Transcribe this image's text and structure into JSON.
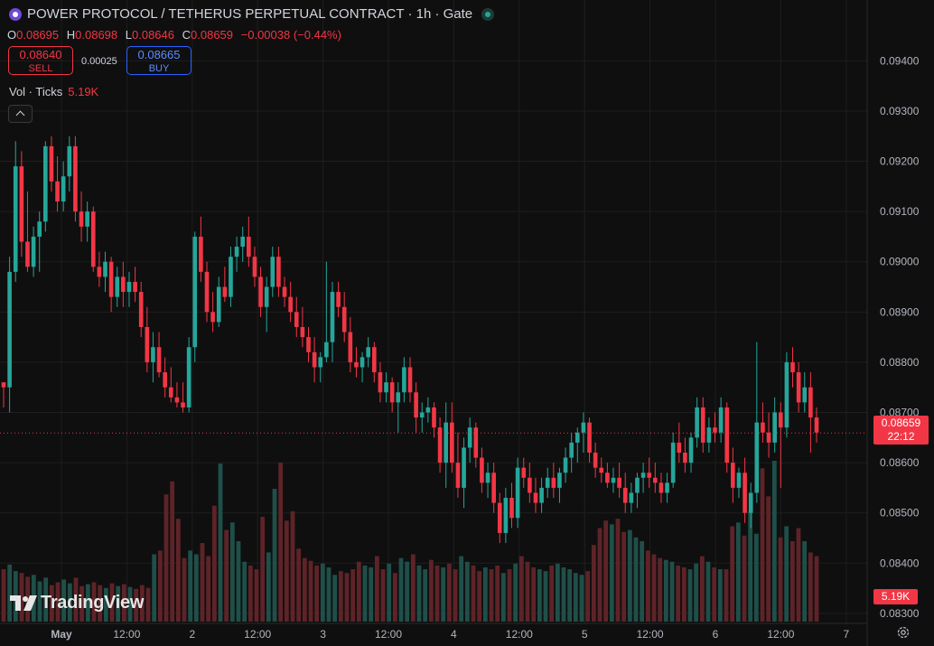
{
  "symbol": {
    "title": "POWER PROTOCOL / TETHERUS PERPETUAL CONTRACT · 1h · Gate",
    "icon": "power-protocol-icon",
    "status_icon": "market-open-dot-icon"
  },
  "ohlc": {
    "o_label": "O",
    "o": "0.08695",
    "h_label": "H",
    "h": "0.08698",
    "l_label": "L",
    "l": "0.08646",
    "c_label": "C",
    "c": "0.08659",
    "change": "−0.00038 (−0.44%)"
  },
  "trade": {
    "sell_price": "0.08640",
    "sell_label": "SELL",
    "spread": "0.00025",
    "buy_price": "0.08665",
    "buy_label": "BUY"
  },
  "volume": {
    "label": "Vol · Ticks",
    "value": "5.19K",
    "tag": "5.19K"
  },
  "price_tag": {
    "price": "0.08659",
    "countdown": "22:12"
  },
  "branding": {
    "name": "TradingView"
  },
  "colors": {
    "up": "#26a69a",
    "down": "#f23645",
    "background": "#0f0f0f",
    "grid": "#1e1e1e"
  },
  "chart_data": {
    "type": "candlestick",
    "interval": "1h",
    "ylim": [
      0.0828,
      0.0946
    ],
    "y_ticks": [
      "0.09400",
      "0.09300",
      "0.09200",
      "0.09100",
      "0.09000",
      "0.08900",
      "0.08800",
      "0.08700",
      "0.08600",
      "0.08500",
      "0.08400",
      "0.08300"
    ],
    "x_ticks": [
      "May",
      "12:00",
      "2",
      "12:00",
      "3",
      "12:00",
      "4",
      "12:00",
      "5",
      "12:00",
      "6",
      "12:00",
      "7"
    ],
    "last_price": 0.08659,
    "candles_ohlc": [
      [
        0.0876,
        0.0876,
        0.0871,
        0.0875
      ],
      [
        0.0875,
        0.0901,
        0.087,
        0.0898
      ],
      [
        0.0898,
        0.0924,
        0.0896,
        0.0919
      ],
      [
        0.0919,
        0.0922,
        0.0901,
        0.0904
      ],
      [
        0.0904,
        0.0914,
        0.0898,
        0.0899
      ],
      [
        0.0899,
        0.0907,
        0.0897,
        0.0905
      ],
      [
        0.0905,
        0.091,
        0.0898,
        0.0908
      ],
      [
        0.0908,
        0.0924,
        0.0906,
        0.0923
      ],
      [
        0.0923,
        0.0925,
        0.0914,
        0.0916
      ],
      [
        0.0916,
        0.0921,
        0.091,
        0.0912
      ],
      [
        0.0912,
        0.092,
        0.091,
        0.0917
      ],
      [
        0.0917,
        0.0925,
        0.0914,
        0.0923
      ],
      [
        0.0923,
        0.0925,
        0.0908,
        0.091
      ],
      [
        0.091,
        0.0914,
        0.0904,
        0.0907
      ],
      [
        0.0907,
        0.0912,
        0.0904,
        0.091
      ],
      [
        0.091,
        0.0911,
        0.0898,
        0.0899
      ],
      [
        0.0899,
        0.0902,
        0.0895,
        0.0897
      ],
      [
        0.0897,
        0.0902,
        0.0894,
        0.09
      ],
      [
        0.09,
        0.0901,
        0.089,
        0.0893
      ],
      [
        0.0893,
        0.0899,
        0.0891,
        0.0897
      ],
      [
        0.0897,
        0.09,
        0.0891,
        0.0894
      ],
      [
        0.0894,
        0.0898,
        0.0891,
        0.0896
      ],
      [
        0.0896,
        0.0899,
        0.0892,
        0.0894
      ],
      [
        0.0894,
        0.0896,
        0.0885,
        0.0887
      ],
      [
        0.0887,
        0.0891,
        0.0878,
        0.088
      ],
      [
        0.088,
        0.0886,
        0.0876,
        0.0883
      ],
      [
        0.0883,
        0.0886,
        0.0877,
        0.0878
      ],
      [
        0.0878,
        0.0881,
        0.0873,
        0.0875
      ],
      [
        0.0875,
        0.0879,
        0.0872,
        0.0873
      ],
      [
        0.0873,
        0.0876,
        0.0871,
        0.0872
      ],
      [
        0.0872,
        0.0876,
        0.087,
        0.0871
      ],
      [
        0.0871,
        0.0885,
        0.087,
        0.0883
      ],
      [
        0.0883,
        0.0906,
        0.088,
        0.0905
      ],
      [
        0.0905,
        0.0909,
        0.0896,
        0.0898
      ],
      [
        0.0898,
        0.09,
        0.0888,
        0.089
      ],
      [
        0.089,
        0.0894,
        0.0886,
        0.0888
      ],
      [
        0.0888,
        0.0897,
        0.0887,
        0.0895
      ],
      [
        0.0895,
        0.0899,
        0.0892,
        0.0893
      ],
      [
        0.0893,
        0.0903,
        0.0891,
        0.0901
      ],
      [
        0.0901,
        0.0905,
        0.0898,
        0.0903
      ],
      [
        0.0903,
        0.0907,
        0.09,
        0.0905
      ],
      [
        0.0905,
        0.0909,
        0.0899,
        0.0901
      ],
      [
        0.0901,
        0.0903,
        0.0895,
        0.0897
      ],
      [
        0.0897,
        0.0899,
        0.0889,
        0.0891
      ],
      [
        0.0891,
        0.0897,
        0.0886,
        0.0895
      ],
      [
        0.0895,
        0.0903,
        0.0893,
        0.0901
      ],
      [
        0.0901,
        0.0903,
        0.0893,
        0.0895
      ],
      [
        0.0895,
        0.0897,
        0.0891,
        0.0893
      ],
      [
        0.0893,
        0.0896,
        0.0888,
        0.089
      ],
      [
        0.089,
        0.0893,
        0.0885,
        0.0887
      ],
      [
        0.0887,
        0.0891,
        0.0883,
        0.0885
      ],
      [
        0.0885,
        0.0887,
        0.088,
        0.0882
      ],
      [
        0.0882,
        0.0885,
        0.0876,
        0.0879
      ],
      [
        0.0879,
        0.0882,
        0.0876,
        0.0881
      ],
      [
        0.0881,
        0.09,
        0.088,
        0.0884
      ],
      [
        0.0884,
        0.0896,
        0.088,
        0.0894
      ],
      [
        0.0894,
        0.0896,
        0.0889,
        0.0891
      ],
      [
        0.0891,
        0.0894,
        0.0884,
        0.0886
      ],
      [
        0.0886,
        0.0889,
        0.0878,
        0.088
      ],
      [
        0.088,
        0.0883,
        0.0877,
        0.0879
      ],
      [
        0.0879,
        0.0882,
        0.0876,
        0.0881
      ],
      [
        0.0881,
        0.0885,
        0.0879,
        0.0883
      ],
      [
        0.0883,
        0.0884,
        0.0876,
        0.0878
      ],
      [
        0.0878,
        0.088,
        0.0872,
        0.0874
      ],
      [
        0.0874,
        0.0878,
        0.0872,
        0.0876
      ],
      [
        0.0876,
        0.0877,
        0.087,
        0.0872
      ],
      [
        0.0872,
        0.0876,
        0.0866,
        0.0874
      ],
      [
        0.0874,
        0.0881,
        0.0872,
        0.0879
      ],
      [
        0.0879,
        0.0881,
        0.0872,
        0.0874
      ],
      [
        0.0874,
        0.0876,
        0.0866,
        0.0869
      ],
      [
        0.0869,
        0.0872,
        0.0866,
        0.087
      ],
      [
        0.087,
        0.0873,
        0.0868,
        0.0871
      ],
      [
        0.0871,
        0.0872,
        0.0865,
        0.0867
      ],
      [
        0.0867,
        0.0869,
        0.0858,
        0.086
      ],
      [
        0.086,
        0.0872,
        0.0855,
        0.0868
      ],
      [
        0.0868,
        0.0872,
        0.0858,
        0.086
      ],
      [
        0.086,
        0.0866,
        0.0853,
        0.0855
      ],
      [
        0.0855,
        0.0865,
        0.0851,
        0.0863
      ],
      [
        0.0863,
        0.0869,
        0.086,
        0.0867
      ],
      [
        0.0867,
        0.0868,
        0.0859,
        0.0861
      ],
      [
        0.0861,
        0.0863,
        0.0854,
        0.0856
      ],
      [
        0.0856,
        0.086,
        0.0853,
        0.0858
      ],
      [
        0.0858,
        0.086,
        0.085,
        0.0852
      ],
      [
        0.0852,
        0.0854,
        0.0844,
        0.0846
      ],
      [
        0.0846,
        0.0855,
        0.0844,
        0.0853
      ],
      [
        0.0853,
        0.0856,
        0.0847,
        0.0849
      ],
      [
        0.0849,
        0.0861,
        0.0847,
        0.0859
      ],
      [
        0.0859,
        0.0861,
        0.0855,
        0.0857
      ],
      [
        0.0857,
        0.086,
        0.0852,
        0.0854
      ],
      [
        0.0854,
        0.0857,
        0.085,
        0.0852
      ],
      [
        0.0852,
        0.0857,
        0.085,
        0.0855
      ],
      [
        0.0855,
        0.0859,
        0.0853,
        0.0857
      ],
      [
        0.0857,
        0.086,
        0.0853,
        0.0855
      ],
      [
        0.0855,
        0.0859,
        0.0852,
        0.0858
      ],
      [
        0.0858,
        0.0863,
        0.0856,
        0.0861
      ],
      [
        0.0861,
        0.0866,
        0.0858,
        0.0864
      ],
      [
        0.0864,
        0.0867,
        0.086,
        0.0866
      ],
      [
        0.0866,
        0.087,
        0.0862,
        0.0868
      ],
      [
        0.0868,
        0.0869,
        0.086,
        0.0862
      ],
      [
        0.0862,
        0.0864,
        0.0857,
        0.0859
      ],
      [
        0.0859,
        0.0861,
        0.0856,
        0.0858
      ],
      [
        0.0858,
        0.086,
        0.0855,
        0.0856
      ],
      [
        0.0856,
        0.0859,
        0.0854,
        0.0857
      ],
      [
        0.0857,
        0.086,
        0.0853,
        0.0855
      ],
      [
        0.0855,
        0.0858,
        0.085,
        0.0852
      ],
      [
        0.0852,
        0.0856,
        0.085,
        0.0854
      ],
      [
        0.0854,
        0.0858,
        0.0851,
        0.0857
      ],
      [
        0.0857,
        0.086,
        0.0854,
        0.0858
      ],
      [
        0.0858,
        0.0861,
        0.0855,
        0.0857
      ],
      [
        0.0857,
        0.086,
        0.0854,
        0.0856
      ],
      [
        0.0856,
        0.0858,
        0.0852,
        0.0854
      ],
      [
        0.0854,
        0.0858,
        0.0852,
        0.0856
      ],
      [
        0.0856,
        0.0866,
        0.0855,
        0.0864
      ],
      [
        0.0864,
        0.0868,
        0.086,
        0.0862
      ],
      [
        0.0862,
        0.0865,
        0.0858,
        0.086
      ],
      [
        0.086,
        0.0866,
        0.0858,
        0.0865
      ],
      [
        0.0865,
        0.0873,
        0.0863,
        0.0871
      ],
      [
        0.0871,
        0.0873,
        0.0862,
        0.0864
      ],
      [
        0.0864,
        0.0869,
        0.0862,
        0.0867
      ],
      [
        0.0867,
        0.087,
        0.0864,
        0.0866
      ],
      [
        0.0866,
        0.0873,
        0.0864,
        0.0871
      ],
      [
        0.0871,
        0.0872,
        0.0858,
        0.086
      ],
      [
        0.086,
        0.0863,
        0.0852,
        0.0855
      ],
      [
        0.0855,
        0.0859,
        0.0853,
        0.0858
      ],
      [
        0.0858,
        0.0861,
        0.0848,
        0.085
      ],
      [
        0.085,
        0.0856,
        0.0847,
        0.0854
      ],
      [
        0.0854,
        0.0884,
        0.0852,
        0.0868
      ],
      [
        0.0868,
        0.0872,
        0.0864,
        0.0866
      ],
      [
        0.0866,
        0.087,
        0.0861,
        0.0864
      ],
      [
        0.0864,
        0.0873,
        0.0862,
        0.087
      ],
      [
        0.087,
        0.0872,
        0.0855,
        0.0867
      ],
      [
        0.0867,
        0.0882,
        0.0865,
        0.088
      ],
      [
        0.088,
        0.0883,
        0.0875,
        0.0878
      ],
      [
        0.0878,
        0.088,
        0.087,
        0.0872
      ],
      [
        0.0872,
        0.0878,
        0.087,
        0.0875
      ],
      [
        0.0875,
        0.0878,
        0.0862,
        0.0869
      ],
      [
        0.0869,
        0.0871,
        0.0864,
        0.0866
      ]
    ],
    "volume_counts": [
      560,
      610,
      540,
      520,
      480,
      500,
      430,
      470,
      390,
      420,
      450,
      410,
      470,
      380,
      400,
      420,
      390,
      360,
      410,
      380,
      400,
      370,
      350,
      390,
      360,
      720,
      760,
      1360,
      1500,
      1100,
      680,
      760,
      720,
      840,
      700,
      1240,
      1690,
      980,
      1060,
      860,
      640,
      600,
      560,
      1120,
      740,
      1420,
      1700,
      1080,
      1180,
      780,
      680,
      650,
      600,
      620,
      580,
      500,
      540,
      520,
      560,
      640,
      600,
      580,
      700,
      560,
      620,
      520,
      680,
      640,
      720,
      600,
      560,
      660,
      600,
      580,
      620,
      560,
      700,
      640,
      600,
      540,
      580,
      560,
      600,
      520,
      560,
      620,
      700,
      640,
      580,
      560,
      540,
      600,
      620,
      580,
      560,
      520,
      500,
      540,
      820,
      1000,
      1080,
      1040,
      1100,
      960,
      980,
      900,
      860,
      760,
      720,
      680,
      660,
      640,
      600,
      580,
      560,
      620,
      700,
      640,
      580,
      560,
      560,
      1020,
      1060,
      920,
      1180,
      940,
      1640,
      1340,
      1720,
      900,
      1020,
      860,
      1000,
      860,
      740,
      700
    ]
  }
}
